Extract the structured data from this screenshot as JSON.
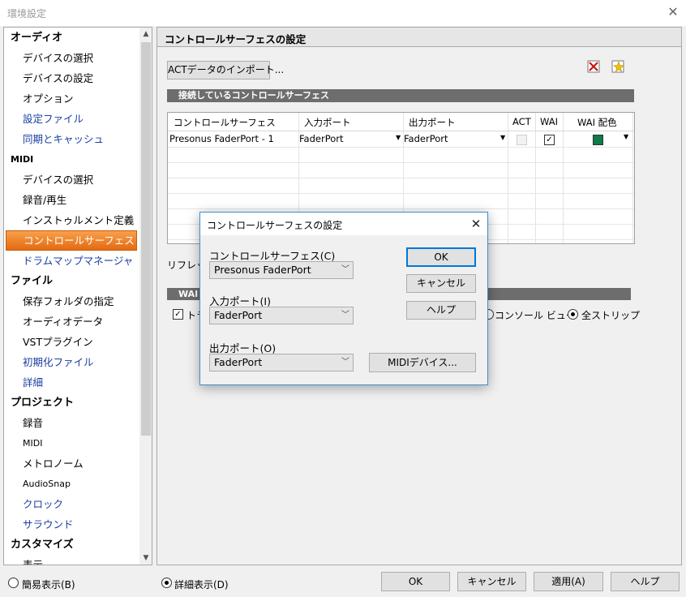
{
  "window": {
    "title": "環境設定"
  },
  "sidebar": {
    "items": [
      {
        "label": "オーディオ",
        "kind": "cat"
      },
      {
        "label": "デバイスの選択",
        "kind": "sub"
      },
      {
        "label": "デバイスの設定",
        "kind": "sub"
      },
      {
        "label": "オプション",
        "kind": "sub"
      },
      {
        "label": "設定ファイル",
        "kind": "sub",
        "blue": true
      },
      {
        "label": "同期とキャッシュ",
        "kind": "sub",
        "blue": true
      },
      {
        "label": "MIDI",
        "kind": "cat",
        "small": true
      },
      {
        "label": "デバイスの選択",
        "kind": "sub"
      },
      {
        "label": "録音/再生",
        "kind": "sub"
      },
      {
        "label": "インストゥルメント定義",
        "kind": "sub"
      },
      {
        "label": "コントロールサーフェス",
        "kind": "sub",
        "selected": true
      },
      {
        "label": "ドラムマップマネージャ",
        "kind": "sub",
        "blue": true
      },
      {
        "label": "ファイル",
        "kind": "cat"
      },
      {
        "label": "保存フォルダの指定",
        "kind": "sub"
      },
      {
        "label": "オーディオデータ",
        "kind": "sub"
      },
      {
        "label": "VSTプラグイン",
        "kind": "sub"
      },
      {
        "label": "初期化ファイル",
        "kind": "sub",
        "blue": true
      },
      {
        "label": "詳細",
        "kind": "sub",
        "blue": true
      },
      {
        "label": "プロジェクト",
        "kind": "cat"
      },
      {
        "label": "録音",
        "kind": "sub"
      },
      {
        "label": "MIDI",
        "kind": "sub",
        "small": true
      },
      {
        "label": "メトロノーム",
        "kind": "sub"
      },
      {
        "label": "AudioSnap",
        "kind": "sub",
        "small": true
      },
      {
        "label": "クロック",
        "kind": "sub",
        "blue": true
      },
      {
        "label": "サラウンド",
        "kind": "sub",
        "blue": true
      },
      {
        "label": "カスタマイズ",
        "kind": "cat"
      },
      {
        "label": "表示",
        "kind": "sub"
      }
    ]
  },
  "panel": {
    "title": "コントロールサーフェスの設定",
    "import_button": "ACTデータのインポート...",
    "section_connected": "接続しているコントロールサーフェス",
    "table": {
      "headers": [
        "コントロールサーフェス",
        "入力ポート",
        "出力ポート",
        "ACT",
        "WAI",
        "WAI 配色"
      ],
      "rows": [
        {
          "surface": "Presonus FaderPort - 1",
          "input": "FaderPort",
          "output": "FaderPort",
          "act": false,
          "wai": true,
          "wai_color": "#0f7a4a"
        }
      ]
    },
    "refresh_label": "リフレッシ",
    "wai_section_label": "WAI",
    "track_check_label": "トラ",
    "radio_console": "コンソール ビュー",
    "radio_all_strips": "全ストリップ"
  },
  "dialog": {
    "title": "コントロールサーフェスの設定",
    "surface_label": "コントロールサーフェス(C)",
    "surface_value": "Presonus FaderPort",
    "input_label": "入力ポート(I)",
    "input_value": "FaderPort",
    "output_label": "出力ポート(O)",
    "output_value": "FaderPort",
    "ok": "OK",
    "cancel": "キャンセル",
    "help": "ヘルプ",
    "midi_devices": "MIDIデバイス..."
  },
  "footer": {
    "simple_view": "簡易表示(B)",
    "detail_view": "詳細表示(D)",
    "ok": "OK",
    "cancel": "キャンセル",
    "apply": "適用(A)",
    "help": "ヘルプ"
  }
}
